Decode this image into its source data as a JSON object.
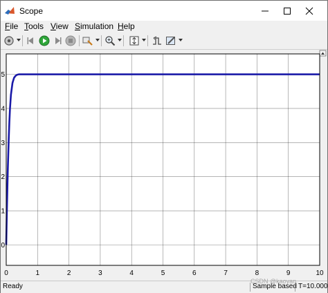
{
  "window": {
    "title": "Scope",
    "controls": [
      "minimize",
      "maximize",
      "close"
    ]
  },
  "menu": {
    "items": [
      {
        "label": "File",
        "mnemonic": "F",
        "rest": "ile"
      },
      {
        "label": "Tools",
        "mnemonic": "T",
        "rest": "ools"
      },
      {
        "label": "View",
        "mnemonic": "V",
        "rest": "iew"
      },
      {
        "label": "Simulation",
        "mnemonic": "S",
        "rest": "imulation"
      },
      {
        "label": "Help",
        "mnemonic": "H",
        "rest": "elp"
      }
    ]
  },
  "toolbar": {
    "icons": [
      "settings-icon",
      "step-back-icon",
      "run-icon",
      "step-forward-icon",
      "stop-icon",
      "highlight-icon",
      "zoom-in-icon",
      "fit-to-view-icon",
      "trigger-icon",
      "style-icon"
    ]
  },
  "chart_data": {
    "type": "line",
    "title": "",
    "xlabel": "",
    "ylabel": "",
    "xlim": [
      0,
      10
    ],
    "ylim": [
      -0.6,
      5.6
    ],
    "xticks": [
      "0",
      "1",
      "2",
      "3",
      "4",
      "5",
      "6",
      "7",
      "8",
      "9",
      "10"
    ],
    "yticks": [
      "0",
      "1",
      "2",
      "3",
      "4",
      "5"
    ],
    "grid": true,
    "series": [
      {
        "color": "#1a1aa8",
        "x": [
          0,
          0.02,
          0.05,
          0.08,
          0.1,
          0.12,
          0.15,
          0.2,
          0.25,
          0.3,
          0.35,
          0.4,
          0.5,
          1,
          2,
          3,
          4,
          5,
          6,
          7,
          8,
          9,
          10
        ],
        "y": [
          0,
          1.0,
          2.2,
          3.1,
          3.6,
          4.0,
          4.4,
          4.75,
          4.9,
          4.96,
          4.99,
          5.0,
          5.0,
          5.0,
          5.0,
          5.0,
          5.0,
          5.0,
          5.0,
          5.0,
          5.0,
          5.0,
          5.0
        ]
      }
    ]
  },
  "status": {
    "state": "Ready",
    "mode": "Sample based",
    "time": "T=10.000"
  },
  "watermark": "CSDN @kaoyan"
}
